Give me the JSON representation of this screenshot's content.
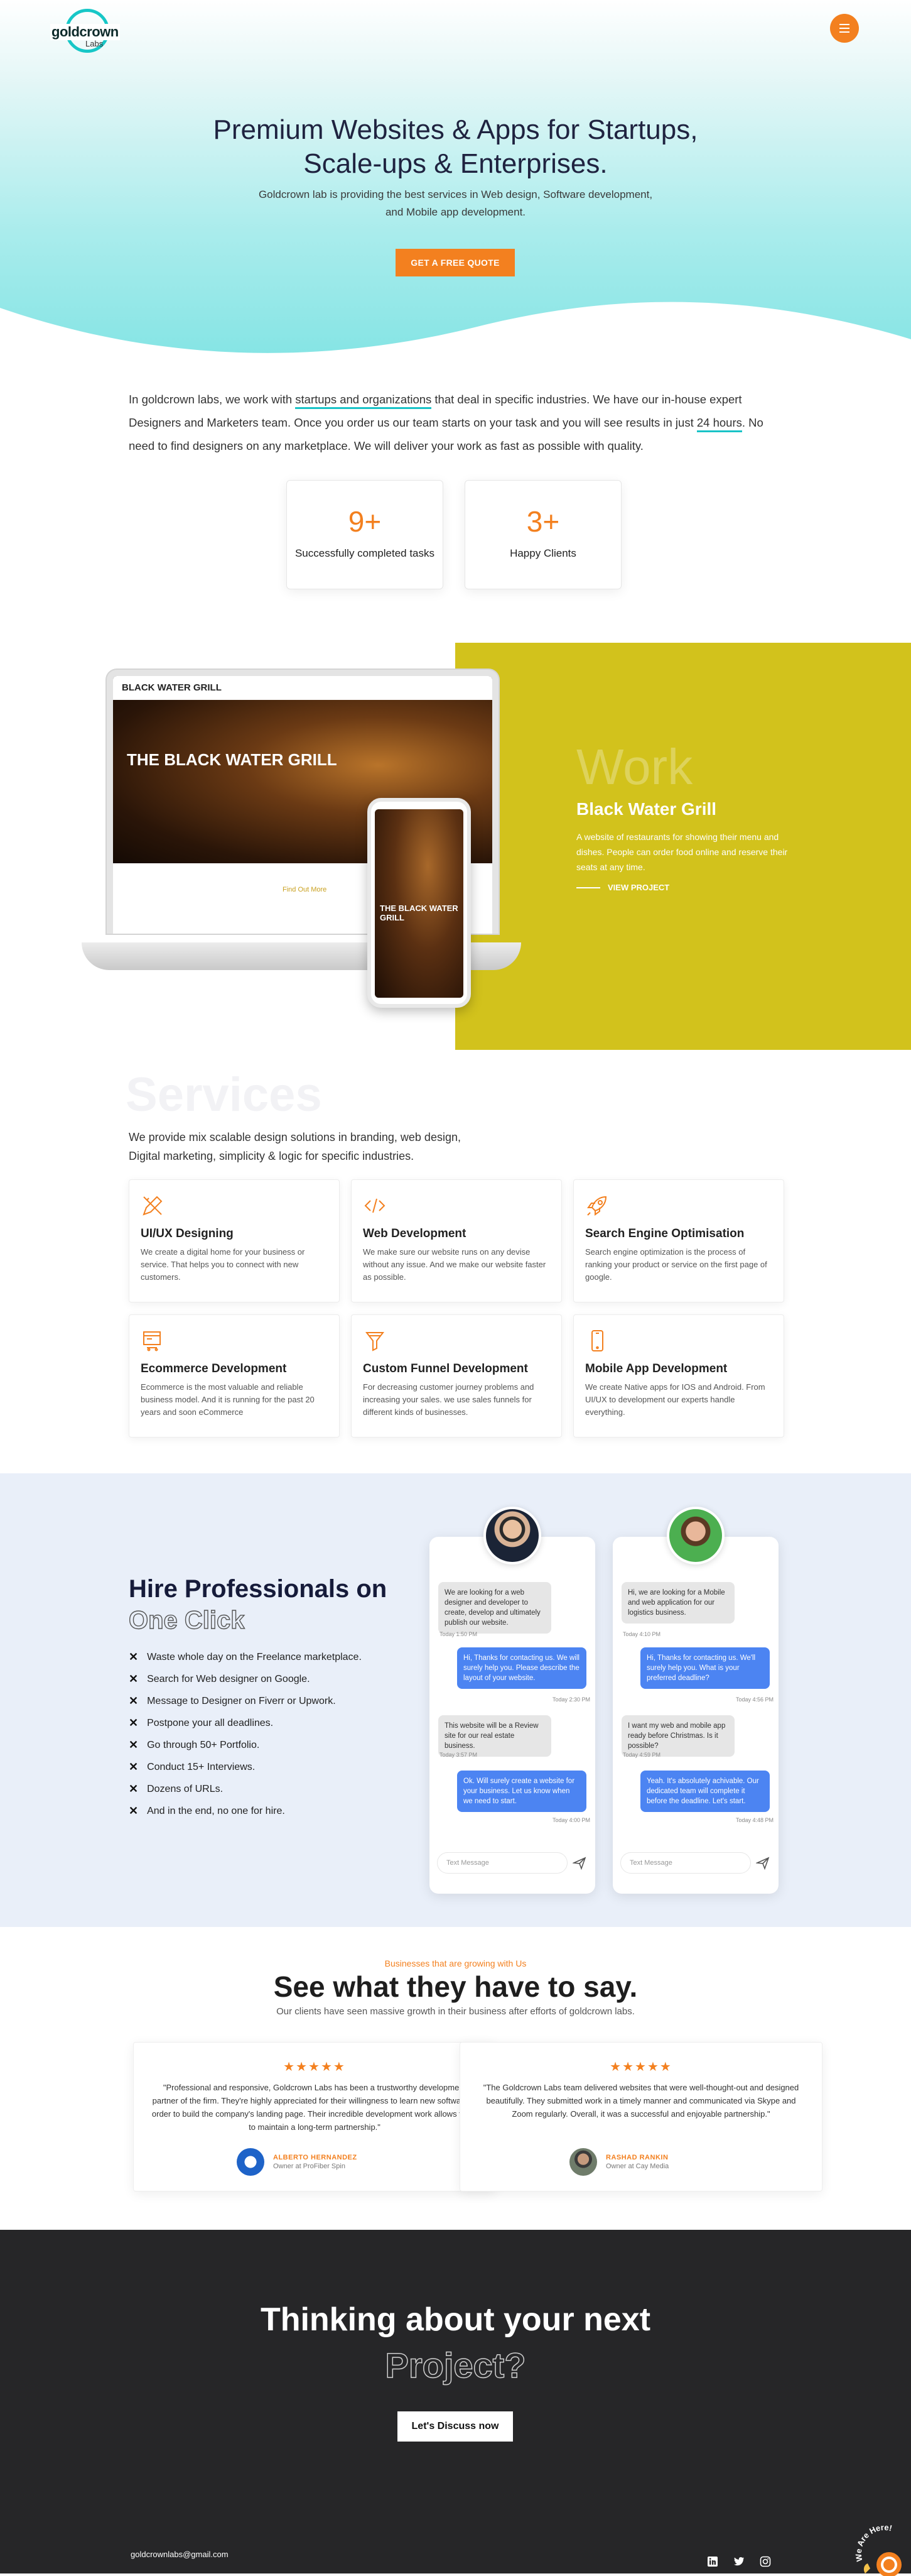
{
  "brand": {
    "logo_main": "goldcrown",
    "logo_sub": "Labs",
    "accent": "#f3801f",
    "teal": "#17c7c7"
  },
  "hero": {
    "title_line1": "Premium Websites & Apps for Startups,",
    "title_line2": "Scale-ups & Enterprises.",
    "subtitle_line1": "Goldcrown lab is providing the best services in Web design, Software development,",
    "subtitle_line2": "and Mobile app development.",
    "cta": "GET A FREE QUOTE"
  },
  "intro": {
    "p1": "In goldcrown labs, we work with ",
    "u1": "startups and organizations",
    "p2": " that deal in specific industries. We have our in-house expert Designers and Marketers team. Once you order us our team starts on your task and you will see results in just ",
    "u2": "24 hours",
    "p3": ". No need to find designers on any marketplace. We will deliver your work as fast as possible with quality."
  },
  "stats": [
    {
      "value": "9+",
      "label": "Successfully completed tasks"
    },
    {
      "value": "3+",
      "label": "Happy Clients"
    }
  ],
  "work": {
    "word": "Work",
    "title": "Black Water Grill",
    "description": "A website of restaurants for showing their menu and dishes. People can order food online and reserve their seats at any time.",
    "link": "VIEW PROJECT",
    "mock_brand": "BLACK WATER GRILL",
    "mock_hero": "THE BLACK WATER GRILL",
    "mock_cta": "Find Out More",
    "band_color": "#d2c21c"
  },
  "services": {
    "word": "Services",
    "intro_line1": "We provide mix scalable design solutions in branding, web design,",
    "intro_line2": "Digital marketing, simplicity & logic for specific industries.",
    "items": [
      {
        "icon": "pencil-ruler-icon",
        "title": "UI/UX Designing",
        "desc": "We create a digital home for your business or service. That helps you to connect with new customers."
      },
      {
        "icon": "code-icon",
        "title": "Web Development",
        "desc": "We make sure our website runs on any devise without any issue. And we make our website faster as possible."
      },
      {
        "icon": "rocket-icon",
        "title": "Search Engine Optimisation",
        "desc": "Search engine optimization is the process of ranking your product or service on the first page of google."
      },
      {
        "icon": "cart-icon",
        "title": "Ecommerce Development",
        "desc": "Ecommerce is the most valuable and reliable business model. And it is running for the past 20 years and soon eCommerce"
      },
      {
        "icon": "funnel-icon",
        "title": "Custom Funnel Development",
        "desc": "For decreasing customer journey problems and increasing your sales. we use sales funnels for different kinds of businesses."
      },
      {
        "icon": "mobile-icon",
        "title": "Mobile App Development",
        "desc": "We create Native apps for IOS and Android. From UI/UX to development our experts handle everything."
      }
    ]
  },
  "hire": {
    "title": "Hire Professionals on",
    "outline": "One Click",
    "points": [
      "Waste whole day on the Freelance marketplace.",
      "Search for Web designer on Google.",
      "Message to Designer on Fiverr or Upwork.",
      "Postpone your all deadlines.",
      "Go through 50+ Portfolio.",
      "Conduct 15+ Interviews.",
      "Dozens of URLs.",
      "And in the end, no one for hire."
    ],
    "chat1": [
      {
        "dir": "in",
        "text": "We are looking for a web designer and developer to create, develop and ultimately publish our website.",
        "time": "Today 1:50 PM"
      },
      {
        "dir": "out",
        "text": "Hi, Thanks for contacting us. We will surely help you. Please describe the layout of your website.",
        "time": "Today 2:30 PM"
      },
      {
        "dir": "in",
        "text": "This website will be a Review site for our real estate business.",
        "time": "Today 3:57 PM"
      },
      {
        "dir": "out",
        "text": "Ok. Will surely create a website for your business. Let us know when we need to start.",
        "time": "Today 4:00 PM"
      }
    ],
    "chat2": [
      {
        "dir": "in",
        "text": "Hi, we are looking for a Mobile and web application for our logistics business.",
        "time": "Today 4:10 PM"
      },
      {
        "dir": "out",
        "text": "Hi, Thanks for contacting us. We'll surely help you. What is your preferred deadline?",
        "time": "Today 4:56 PM"
      },
      {
        "dir": "in",
        "text": "I want my web and mobile app ready before Christmas. Is it possible?",
        "time": "Today 4:59 PM"
      },
      {
        "dir": "out",
        "text": "Yeah. It's absolutely achivable. Our dedicated team will complete it before the deadline. Let's start.",
        "time": "Today 4:48 PM"
      }
    ],
    "input_placeholder": "Text Message"
  },
  "testimonials": {
    "kicker": "Businesses that are growing with Us",
    "title": "See what they have to say.",
    "subtitle": "Our clients have seen massive growth in their business after efforts of goldcrown labs.",
    "items": [
      {
        "stars": "★★★★★",
        "quote": "\"Professional and responsive, Goldcrown Labs has been a trustworthy development partner of the firm. They're highly appreciated for their willingness to learn new software in order to build the company's landing page. Their incredible development work allows them to maintain a long-term partnership.\"",
        "name": "ALBERTO HERNANDEZ",
        "role": "Owner at ProFiber Spin"
      },
      {
        "stars": "★★★★★",
        "quote": "\"The Goldcrown Labs team delivered websites that were well-thought-out and designed beautifully. They submitted work in a timely manner and communicated via Skype and Zoom regularly. Overall, it was a successful and enjoyable partnership.\"",
        "name": "RASHAD RANKIN",
        "role": "Owner at Cay Media"
      }
    ]
  },
  "footer": {
    "title": "Thinking about your next",
    "outline": "Project?",
    "button": "Let's Discuss now",
    "email": "goldcrownlabs@gmail.com",
    "hiring_badge": "We Are Here!"
  }
}
